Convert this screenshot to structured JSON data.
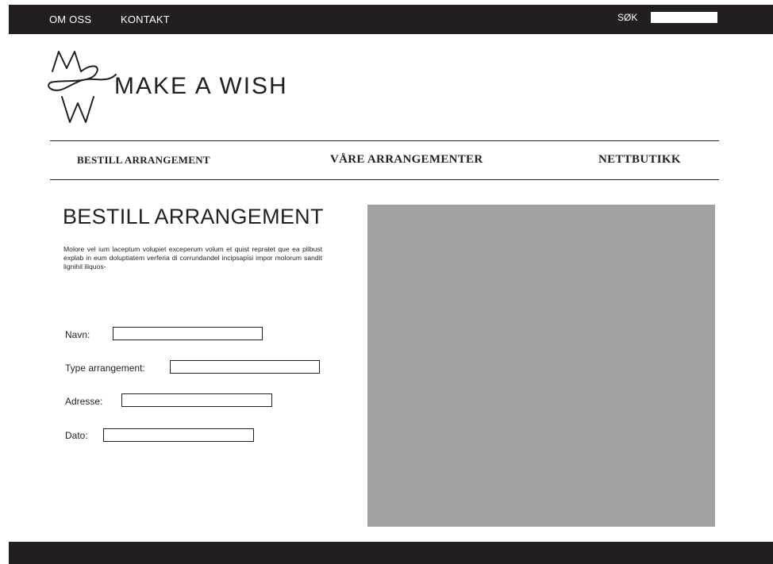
{
  "topbar": {
    "links": [
      "OM OSS",
      "KONTAKT"
    ],
    "search_label": "SØK",
    "search_value": ""
  },
  "brand": {
    "name": "MAKE A WISH"
  },
  "main_nav": {
    "items": [
      "BESTILL ARRANGEMENT",
      "VÅRE ARRANGEMENTER",
      "NETTBUTIKK"
    ]
  },
  "content": {
    "title": "BESTILL ARRANGEMENT",
    "intro": "Molore vel ium laceptum volupiet exceperum volum et quist repratet que ea plibust explab in eum doluptiatem verferia di corrundandel incipsapisi impor molorum sandit lignihil iliquos-"
  },
  "form": {
    "fields": [
      {
        "label": "Navn:",
        "value": ""
      },
      {
        "label": "Type arrangement:",
        "value": ""
      },
      {
        "label": "Adresse:",
        "value": ""
      },
      {
        "label": "Dato:",
        "value": ""
      }
    ]
  },
  "colors": {
    "dark": "#231f20",
    "placeholder": "#a2a2a4",
    "background": "#ffffff"
  },
  "icons": {
    "logo": "mw-monogram-icon"
  }
}
